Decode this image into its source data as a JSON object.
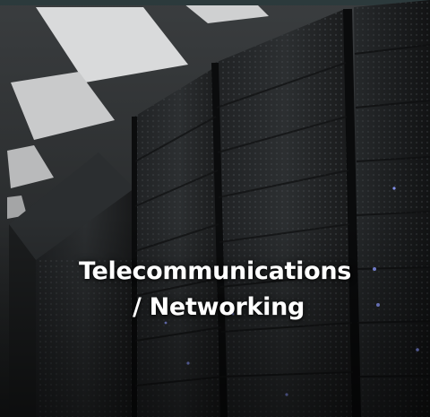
{
  "tile": {
    "title_line_1": "Telecommunications",
    "title_line_2": "/ Networking",
    "background_icon": "server-racks-photo",
    "colors": {
      "text": "#ffffff",
      "background": "#151617",
      "led_accent": "#8f9cff"
    }
  }
}
